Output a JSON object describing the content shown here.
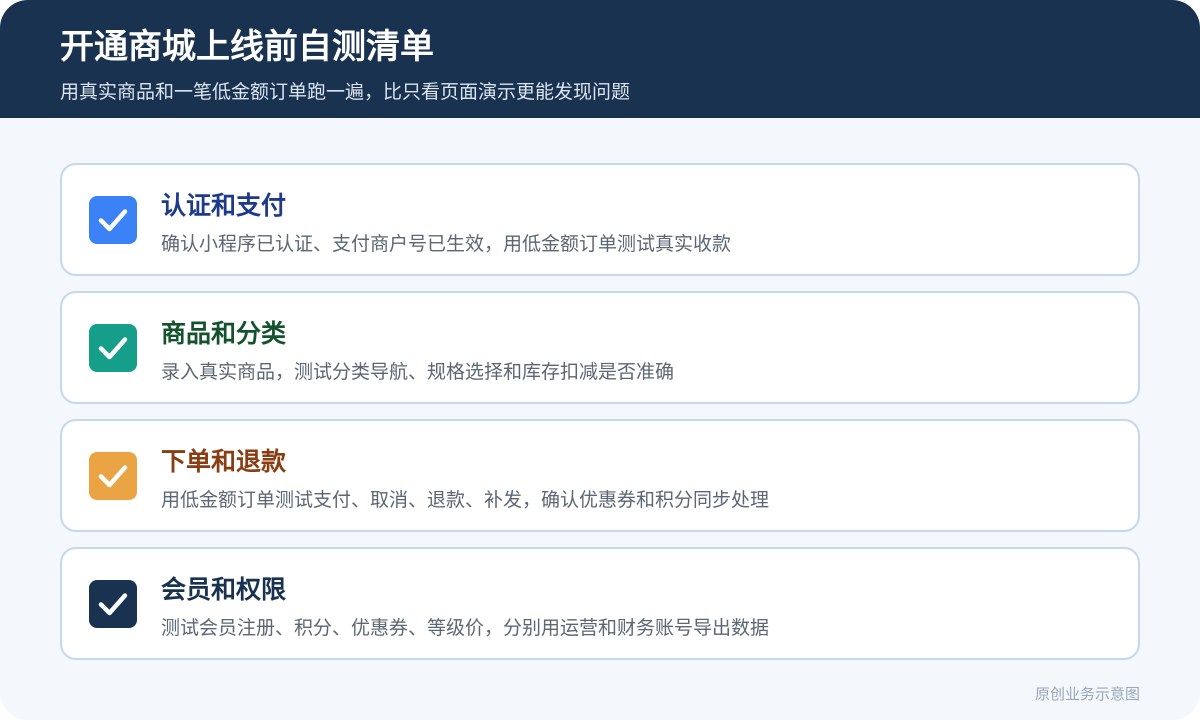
{
  "header": {
    "title": "开通商城上线前自测清单",
    "subtitle": "用真实商品和一笔低金额订单跑一遍，比只看页面演示更能发现问题"
  },
  "items": [
    {
      "title": "认证和支付",
      "description": "确认小程序已认证、支付商户号已生效，用低金额订单测试真实收款",
      "color": "#3b82f6",
      "title_color": "#1e3a8a",
      "icon": "check-icon"
    },
    {
      "title": "商品和分类",
      "description": "录入真实商品，测试分类导航、规格选择和库存扣减是否准确",
      "color": "#159f8b",
      "title_color": "#14532d",
      "icon": "check-icon"
    },
    {
      "title": "下单和退款",
      "description": "用低金额订单测试支付、取消、退款、补发，确认优惠券和积分同步处理",
      "color": "#eba443",
      "title_color": "#8a3d12",
      "icon": "check-icon"
    },
    {
      "title": "会员和权限",
      "description": "测试会员注册、积分、优惠券、等级价，分别用运营和财务账号导出数据",
      "color": "#18324f",
      "title_color": "#18324f",
      "icon": "check-icon"
    }
  ],
  "footer": {
    "note": "原创业务示意图"
  }
}
